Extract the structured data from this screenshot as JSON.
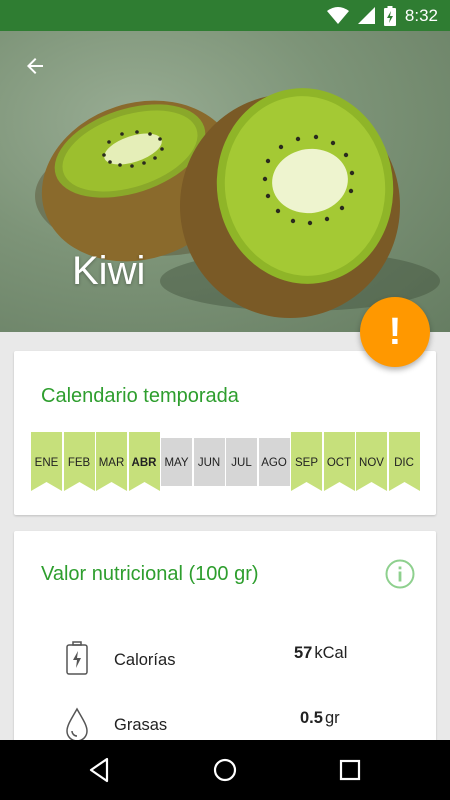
{
  "status_bar": {
    "time": "8:32",
    "icons": [
      "wifi-icon",
      "signal-icon",
      "battery-charging-icon"
    ]
  },
  "hero": {
    "title": "Kiwi",
    "back_icon": "arrow-left-icon"
  },
  "fab": {
    "label": "!",
    "icon": "alert-icon",
    "color": "#ff9800"
  },
  "season": {
    "title": "Calendario temporada",
    "current_month": "ABR",
    "months": [
      {
        "label": "ENE",
        "in_season": true
      },
      {
        "label": "FEB",
        "in_season": true
      },
      {
        "label": "MAR",
        "in_season": true
      },
      {
        "label": "ABR",
        "in_season": true
      },
      {
        "label": "MAY",
        "in_season": false
      },
      {
        "label": "JUN",
        "in_season": false
      },
      {
        "label": "JUL",
        "in_season": false
      },
      {
        "label": "AGO",
        "in_season": false
      },
      {
        "label": "SEP",
        "in_season": true
      },
      {
        "label": "OCT",
        "in_season": true
      },
      {
        "label": "NOV",
        "in_season": true
      },
      {
        "label": "DIC",
        "in_season": true
      }
    ],
    "in_season_color": "#c6e07b",
    "off_season_color": "#d6d6d6"
  },
  "nutrition": {
    "title": "Valor nutricional (100 gr)",
    "info_icon": "info-icon",
    "items": [
      {
        "name": "Calorías",
        "value": "57",
        "unit": "kCal",
        "icon": "battery-bolt-icon"
      },
      {
        "name": "Grasas",
        "value": "0.5",
        "unit": "gr",
        "icon": "drop-icon"
      }
    ]
  },
  "colors": {
    "primary_dark": "#2f7d32",
    "title_green": "#2e9e2e",
    "accent": "#ff9800"
  },
  "nav_bar": {
    "buttons": [
      "back-triangle-icon",
      "home-circle-icon",
      "recents-square-icon"
    ]
  }
}
